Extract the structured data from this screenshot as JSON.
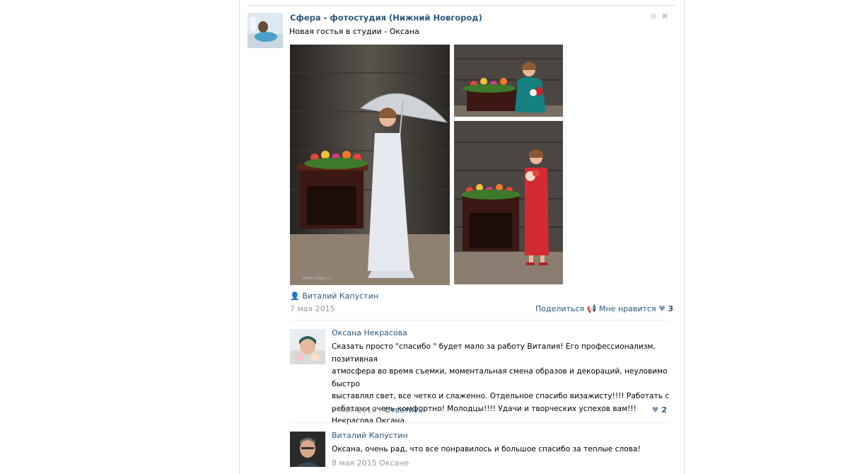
{
  "post": {
    "author": "Сфера - фотостудия (Нижний Новгород)",
    "text": "Новая гостья в студии - Оксана",
    "signer": "Виталий Капустин",
    "date": "7 мая 2015",
    "share_label": "Поделиться",
    "like_label": "Мне нравится",
    "like_count": "3",
    "watermark": "www.vikop.ru"
  },
  "comments": [
    {
      "author": "Оксана Некрасова",
      "lines": [
        "Сказать просто \"спасибо \" будет мало за работу Виталия! Его профессионализм, позитивная",
        "атмосфера во время съемки, моментальная смена образов и декораций, неуловимо быстро",
        "выставлял свет, все четко и слаженно. Отдельное спасибо визажисту!!!! Работать с",
        "ребятами очень комфортно! Молодцы!!!! Удачи и творческих успехов вам!!!",
        "Некрасова Оксана."
      ],
      "date": "7 мая 2015",
      "separator": "|",
      "reply_label": "Ответить",
      "likes": "2"
    },
    {
      "author": "Виталий Капустин",
      "lines": [
        "Оксана, очень рад, что все понравилось и большое спасибо за теплые слова!"
      ],
      "date": "8 мая 2015",
      "reply_to": "Оксане"
    }
  ],
  "colors": {
    "link": "#2b587a",
    "muted": "#999999",
    "border": "#dbe2e8",
    "heart": "#7d9ab8"
  }
}
